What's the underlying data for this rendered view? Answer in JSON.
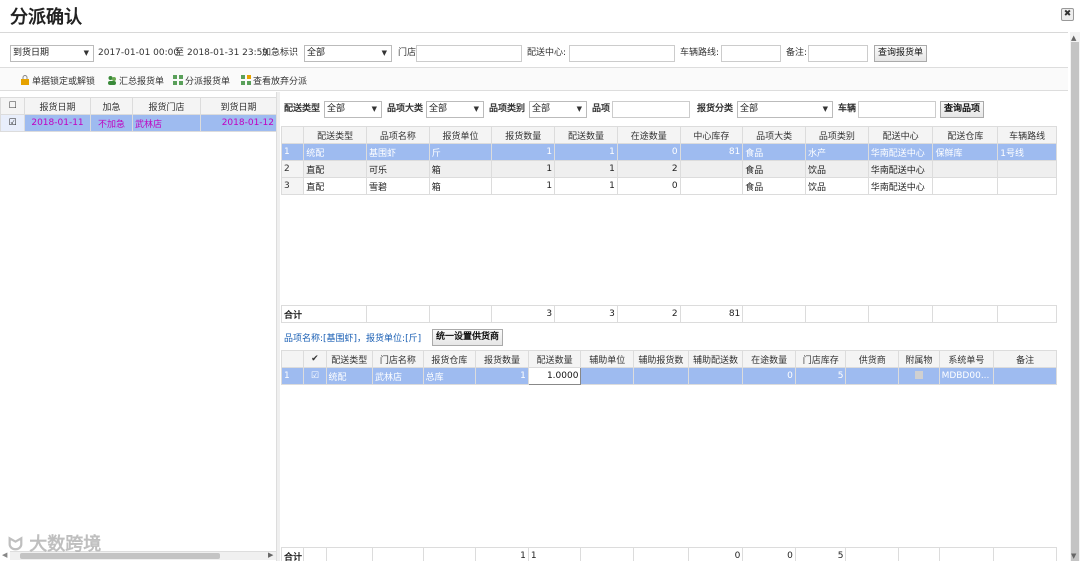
{
  "dialog": {
    "title": "分派确认",
    "close": "✖"
  },
  "filter": {
    "date_type": "到货日期",
    "start": "2017-01-01 00:00",
    "to": "至",
    "end": "2018-01-31 23:59",
    "urgent_label": "加急标识",
    "urgent_value": "全部",
    "store_label": "门店:",
    "store_value": "",
    "dc_label": "配送中心:",
    "dc_value": "",
    "route_label": "车辆路线:",
    "route_value": "",
    "note_label": "备注:",
    "note_value": "",
    "query_btn": "查询报货单"
  },
  "toolbar": [
    {
      "label": "单据锁定或解锁",
      "icon": "lock-icon"
    },
    {
      "label": "汇总报货单",
      "icon": "people-icon"
    },
    {
      "label": "分派报货单",
      "icon": "distribute-icon"
    },
    {
      "label": "查看放弃分派",
      "icon": "view-abandon-icon"
    }
  ],
  "left_table": {
    "headers": [
      "",
      "报货日期",
      "加急",
      "报货门店",
      "到货日期"
    ],
    "rows": [
      {
        "checked": true,
        "date": "2018-01-11",
        "urgent": "不加急",
        "store": "武林店",
        "arrive": "2018-01-12"
      }
    ]
  },
  "filter2": {
    "type_label": "配送类型",
    "type_value": "全部",
    "cat_label": "品项大类",
    "cat_value": "全部",
    "sub_label": "品项类别",
    "sub_value": "全部",
    "item_label": "品项",
    "item_value": "",
    "cls_label": "报货分类",
    "cls_value": "全部",
    "car_label": "车辆",
    "car_value": "",
    "query_btn": "查询品项"
  },
  "items_table": {
    "headers": [
      "",
      "配送类型",
      "品项名称",
      "报货单位",
      "报货数量",
      "配送数量",
      "在途数量",
      "中心库存",
      "品项大类",
      "品项类别",
      "配送中心",
      "配送仓库",
      "车辆路线"
    ],
    "rows": [
      [
        "1",
        "统配",
        "基围虾",
        "斤",
        "1",
        "1",
        "0",
        "81",
        "食品",
        "水产",
        "华南配送中心",
        "保鲜库",
        "1号线"
      ],
      [
        "2",
        "直配",
        "可乐",
        "箱",
        "1",
        "1",
        "2",
        "",
        "食品",
        "饮品",
        "华南配送中心",
        "",
        ""
      ],
      [
        "3",
        "直配",
        "雪碧",
        "箱",
        "1",
        "1",
        "0",
        "",
        "食品",
        "饮品",
        "华南配送中心",
        "",
        ""
      ]
    ],
    "total_label": "合计",
    "totals": [
      "3",
      "3",
      "2",
      "81"
    ]
  },
  "detail": {
    "hint": "品项名称:[基围虾]，报货单位:[斤]",
    "set_supplier_btn": "统一设置供货商",
    "headers": [
      "",
      "✔",
      "配送类型",
      "门店名称",
      "报货仓库",
      "报货数量",
      "配送数量",
      "辅助单位",
      "辅助报货数",
      "辅助配送数",
      "在途数量",
      "门店库存",
      "供货商",
      "附属物",
      "系统单号",
      "备注"
    ],
    "rows": [
      {
        "no": "1",
        "checked": true,
        "type": "统配",
        "store": "武林店",
        "wh": "总库",
        "qty": "1",
        "dist": "1.0000",
        "aux_unit": "",
        "aux_req": "",
        "aux_dist": "",
        "transit": "0",
        "stock": "5",
        "supplier": "",
        "attach": "",
        "sys_no": "MDBD00...",
        "note": ""
      }
    ],
    "total_label": "合计",
    "totals": {
      "qty": "1",
      "dist": "1",
      "transit": "0",
      "stock_a": "0",
      "stock_b": "5"
    }
  },
  "watermark": "大数跨境"
}
